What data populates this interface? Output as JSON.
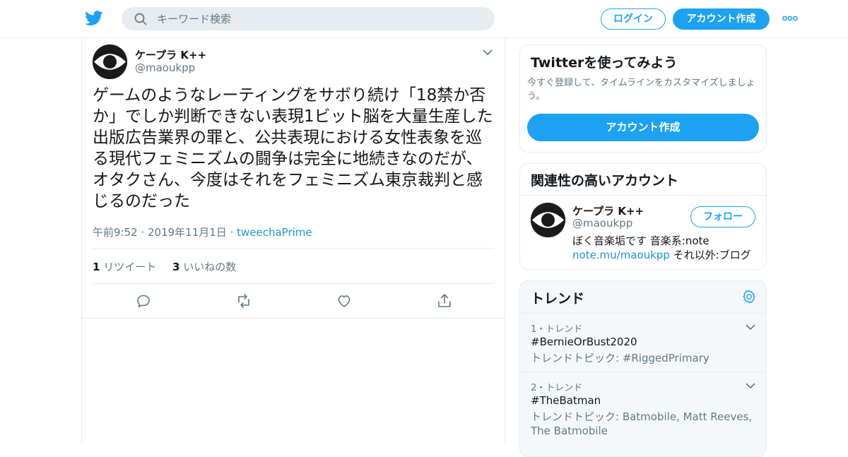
{
  "header": {
    "search_placeholder": "キーワード検索",
    "login_label": "ログイン",
    "signup_label": "アカウント作成"
  },
  "tweet": {
    "author_name": "ケープラ K++",
    "author_handle": "@maoukpp",
    "text": "ゲームのようなレーティングをサボり続け「18禁か否か」でしか判断できない表現1ビット脳を大量生産した出版広告業界の罪と、公共表現における女性表象を巡る現代フェミニズムの闘争は完全に地続きなのだが、オタクさん、今度はそれをフェミニズム東京裁判と感じるのだった",
    "time": "午前9:52 · 2019年11月1日",
    "separator": " · ",
    "source": "tweechaPrime",
    "retweet_count": "1",
    "retweet_label": "リツイート",
    "like_count": "3",
    "like_label": "いいねの数"
  },
  "signup_card": {
    "title": "Twitterを使ってみよう",
    "description": "今すぐ登録して、タイムラインをカスタマイズしましょう。",
    "button_label": "アカウント作成"
  },
  "related": {
    "title": "関連性の高いアカウント",
    "name": "ケープラ K++",
    "handle": "@maoukpp",
    "follow_label": "フォロー",
    "bio_line1": "ぼく音楽垢です 音楽系:note",
    "bio_link": "note.mu/maoukpp",
    "bio_rest": " それ以外:ブログ"
  },
  "trends": {
    "title": "トレンド",
    "items": [
      {
        "meta": "1・トレンド",
        "tag": "#BernieOrBust2020",
        "topic": "トレンドトピック: #RiggedPrimary"
      },
      {
        "meta": "2・トレンド",
        "tag": "#TheBatman",
        "topic": "トレンドトピック: Batmobile, Matt Reeves, The Batmobile"
      }
    ]
  },
  "colors": {
    "brand": "#1da1f2",
    "link": "#1b95e0",
    "muted": "#657786",
    "border": "#e6ecf0"
  }
}
